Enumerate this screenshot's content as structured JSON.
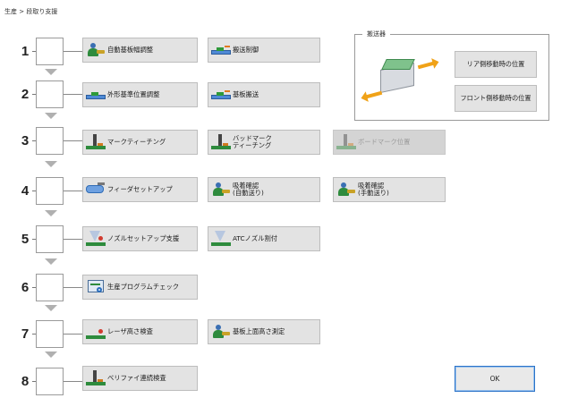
{
  "breadcrumb": "生産 > 段取り支援",
  "steps": [
    {
      "number": "1",
      "buttons": [
        "自動基板幅調整",
        "搬送制御"
      ]
    },
    {
      "number": "2",
      "buttons": [
        "外形基準位置調整",
        "基板搬送"
      ]
    },
    {
      "number": "3",
      "buttons": [
        "マークティーチング",
        "バッドマーク\nティーチング",
        "ボードマーク位置"
      ]
    },
    {
      "number": "4",
      "buttons": [
        "フィーダセットアップ",
        "吸着確認\n(自動送り)",
        "吸着確認\n(手動送り)"
      ]
    },
    {
      "number": "5",
      "buttons": [
        "ノズルセットアップ支援",
        "ATCノズル割付"
      ]
    },
    {
      "number": "6",
      "buttons": [
        "生産プログラムチェック"
      ]
    },
    {
      "number": "7",
      "buttons": [
        "レーザ高さ検査",
        "基板上面高さ測定"
      ]
    },
    {
      "number": "8",
      "buttons": [
        "ベリファイ連続検査"
      ]
    }
  ],
  "conveyor_group": {
    "title": "搬送器",
    "rear_button": "リア側移動時の位置",
    "front_button": "フロント側移動時の位置"
  },
  "ok_button": "OK",
  "disabled_buttons": [
    "ボードマーク位置"
  ],
  "colors": {
    "accent": "#2b73c8",
    "button_bg": "#e3e3e3"
  }
}
